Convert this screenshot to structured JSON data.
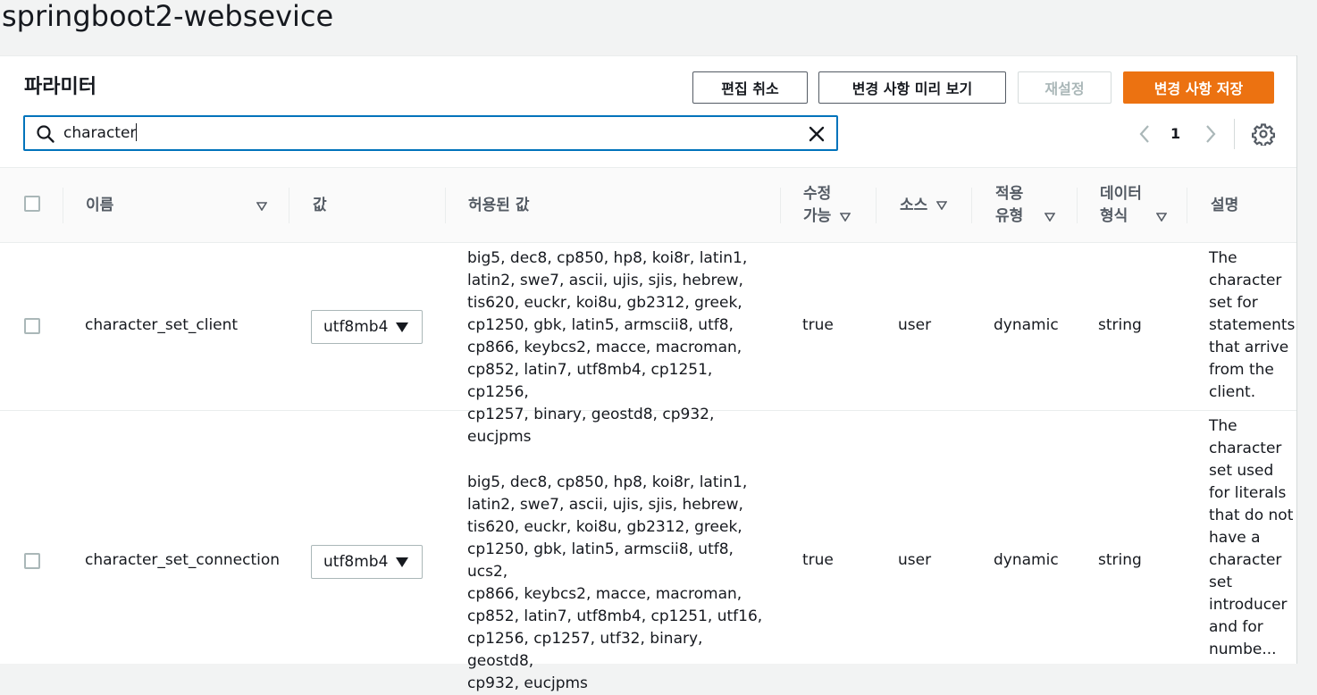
{
  "app": {
    "title": "springboot2-websevice"
  },
  "panel": {
    "title": "파라미터",
    "buttons": {
      "cancel_edit": "편집 취소",
      "preview_changes": "변경 사항 미리 보기",
      "reset": "재설정",
      "save_changes": "변경 사항 저장"
    },
    "search": {
      "value": "character"
    },
    "pagination": {
      "current_page": "1"
    }
  },
  "table": {
    "columns": {
      "name": "이름",
      "value": "값",
      "allowed_values": "허용된 값",
      "modifiable": [
        "수정",
        "가능"
      ],
      "source": "소스",
      "apply_type": [
        "적용",
        "유형"
      ],
      "data_type": [
        "데이터",
        "형식"
      ],
      "description": "설명"
    },
    "rows": [
      {
        "name": "character_set_client",
        "value": "utf8mb4",
        "allowed_lines": [
          "big5, dec8, cp850, hp8, koi8r, latin1,",
          "latin2, swe7, ascii, ujis, sjis, hebrew,",
          "tis620, euckr, koi8u, gb2312, greek,",
          "cp1250, gbk, latin5, armscii8, utf8,",
          "cp866, keybcs2, macce, macroman,",
          "cp852, latin7, utf8mb4, cp1251, cp1256,",
          "cp1257, binary, geostd8, cp932, eucjpms"
        ],
        "modifiable": "true",
        "source": "user",
        "apply_type": "dynamic",
        "data_type": "string",
        "description_lines": [
          "The",
          "character",
          "set for",
          "statements",
          "that arrive",
          "from the",
          "client."
        ]
      },
      {
        "name": "character_set_connection",
        "value": "utf8mb4",
        "allowed_lines": [
          "big5, dec8, cp850, hp8, koi8r, latin1,",
          "latin2, swe7, ascii, ujis, sjis, hebrew,",
          "tis620, euckr, koi8u, gb2312, greek,",
          "cp1250, gbk, latin5, armscii8, utf8, ucs2,",
          "cp866, keybcs2, macce, macroman,",
          "cp852, latin7, utf8mb4, cp1251, utf16,",
          "cp1256, cp1257, utf32, binary, geostd8,",
          "cp932, eucjpms"
        ],
        "modifiable": "true",
        "source": "user",
        "apply_type": "dynamic",
        "data_type": "string",
        "description_lines": [
          "The",
          "character",
          "set used",
          "for literals",
          "that do not",
          "have a",
          "character",
          "set",
          "introducer",
          "and for",
          "numbe..."
        ]
      }
    ]
  }
}
